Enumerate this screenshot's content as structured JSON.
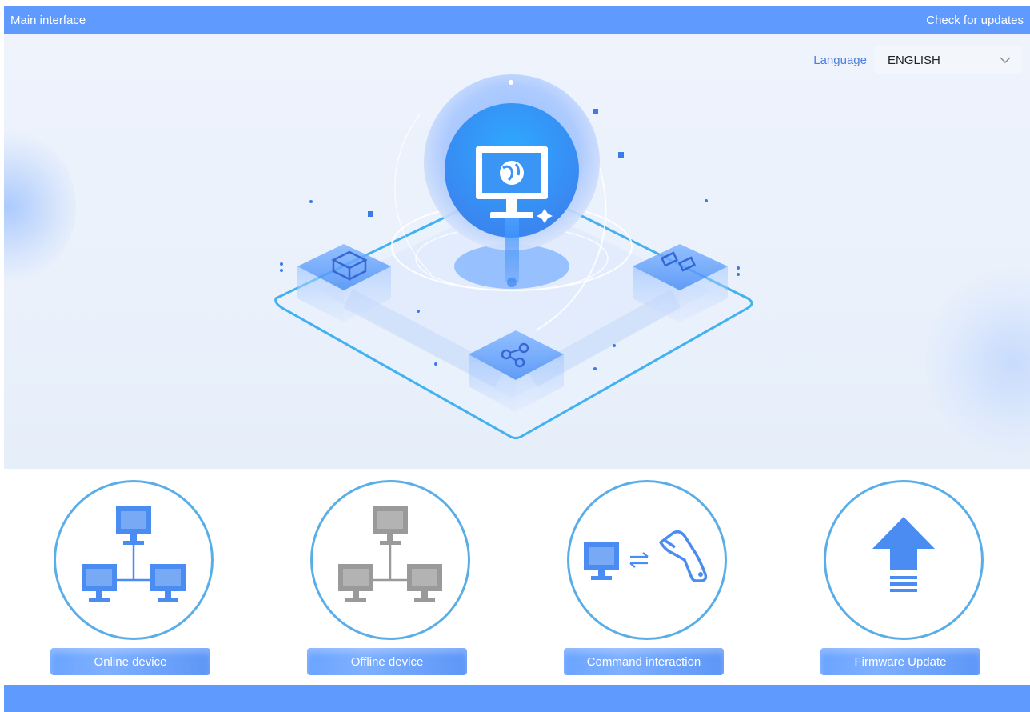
{
  "titlebar": {
    "title": "Main interface",
    "update_label": "Check for updates"
  },
  "language": {
    "label": "Language",
    "selected": "ENGLISH"
  },
  "tiles": [
    {
      "label": "Online device",
      "icon": "online-network-icon"
    },
    {
      "label": "Offline device",
      "icon": "offline-network-icon"
    },
    {
      "label": "Command interaction",
      "icon": "pc-scanner-exchange-icon"
    },
    {
      "label": "Firmware Update",
      "icon": "upload-arrow-icon"
    }
  ],
  "colors": {
    "accent": "#5f9bff",
    "ring": "#5aaee8",
    "icon_blue": "#4a8cf2",
    "icon_gray": "#9a9a9a"
  }
}
